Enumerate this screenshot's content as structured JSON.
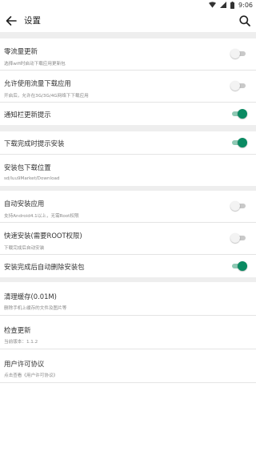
{
  "status": {
    "time": "9:06"
  },
  "header": {
    "title": "设置"
  },
  "colors": {
    "accent": "#0a8a62",
    "divider": "#eeeeee"
  },
  "group1": [
    {
      "label": "零流量更新",
      "sub": "选择wifi时启动下载应用更新包",
      "on": false
    },
    {
      "label": "允许使用流量下载应用",
      "sub": "开启后，允许在3G/3G/4G网络下下载应用",
      "on": false
    },
    {
      "label": "通知栏更新提示",
      "on": true
    }
  ],
  "group2": [
    {
      "label": "下载完成时提示安装",
      "on": true
    },
    {
      "label": "安装包下载位置",
      "sub": "sd/luu9Market/Download"
    }
  ],
  "group3": [
    {
      "label": "自动安装应用",
      "sub": "支持Android4.1以上，无需Root权限",
      "on": false
    },
    {
      "label": "快速安装(需要ROOT权限)",
      "sub": "下载完成后自动安装",
      "on": false
    },
    {
      "label": "安装完成后自动删除安装包",
      "on": true
    }
  ],
  "group4": [
    {
      "label": "清理缓存(0.01M)",
      "sub": "删除手机上缓存的文件及图片等"
    },
    {
      "label": "检查更新",
      "sub": "当前版本：1.1.2"
    },
    {
      "label": "用户许可协议",
      "sub": "点击查看《用户许可协议》"
    }
  ]
}
